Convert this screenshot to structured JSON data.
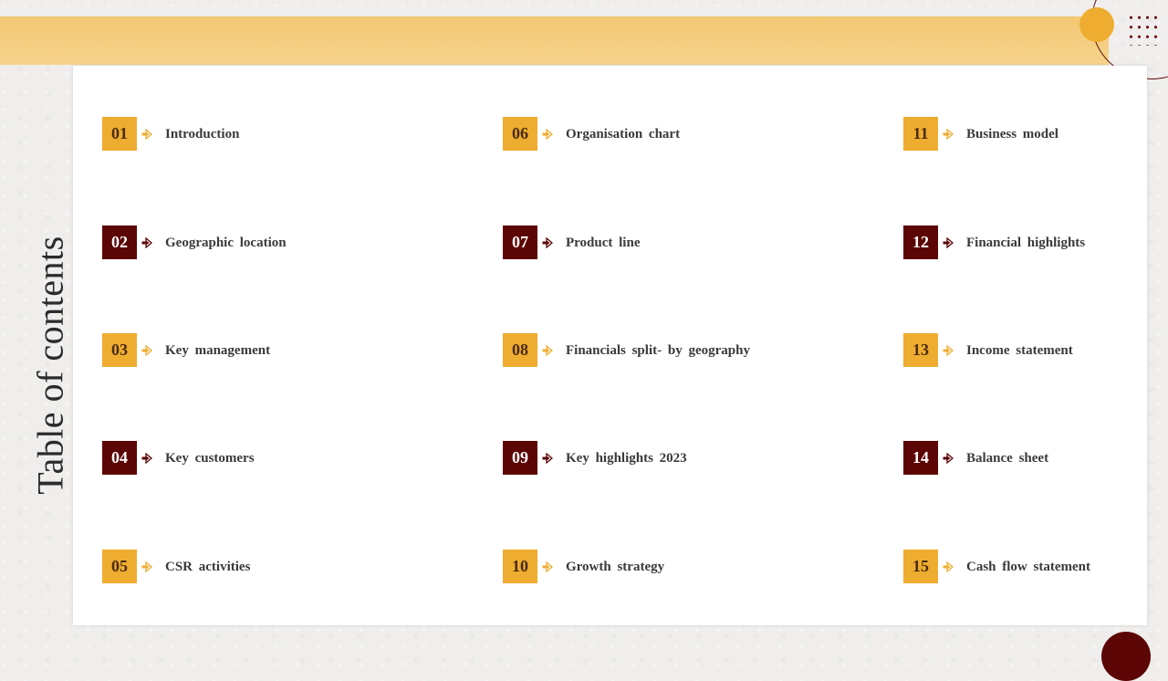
{
  "title": "Table of contents",
  "colors": {
    "gold": "#eead30",
    "maroon": "#5c0505",
    "band": "#f4cb7c"
  },
  "items": [
    {
      "num": "01",
      "label": "Introduction",
      "style": "gold"
    },
    {
      "num": "02",
      "label": "Geographic  location",
      "style": "maroon"
    },
    {
      "num": "03",
      "label": "Key management",
      "style": "gold"
    },
    {
      "num": "04",
      "label": "Key customers",
      "style": "maroon"
    },
    {
      "num": "05",
      "label": "CSR activities",
      "style": "gold"
    },
    {
      "num": "06",
      "label": "Organisation  chart",
      "style": "gold"
    },
    {
      "num": "07",
      "label": "Product  line",
      "style": "maroon"
    },
    {
      "num": "08",
      "label": "Financials  split- by geography",
      "style": "gold"
    },
    {
      "num": "09",
      "label": "Key highlights  2023",
      "style": "maroon"
    },
    {
      "num": "10",
      "label": "Growth  strategy",
      "style": "gold"
    },
    {
      "num": "11",
      "label": "Business model",
      "style": "gold"
    },
    {
      "num": "12",
      "label": "Financial  highlights",
      "style": "maroon"
    },
    {
      "num": "13",
      "label": "Income statement",
      "style": "gold"
    },
    {
      "num": "14",
      "label": "Balance sheet",
      "style": "maroon"
    },
    {
      "num": "15",
      "label": "Cash flow  statement",
      "style": "gold"
    }
  ]
}
